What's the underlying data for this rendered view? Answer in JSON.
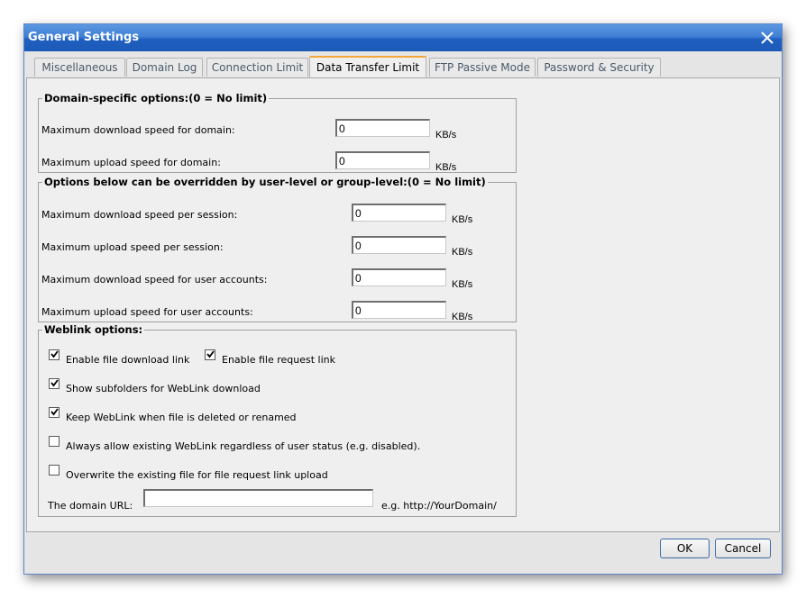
{
  "dialog": {
    "title": "General Settings",
    "close_icon": "close-icon"
  },
  "tabs": [
    {
      "label": "Miscellaneous",
      "active": false
    },
    {
      "label": "Domain Log",
      "active": false
    },
    {
      "label": "Connection Limit",
      "active": false
    },
    {
      "label": "Data Transfer Limit",
      "active": true
    },
    {
      "label": "FTP Passive Mode",
      "active": false
    },
    {
      "label": "Password & Security",
      "active": false
    }
  ],
  "domain_group": {
    "legend": "Domain-specific options:(0 = No limit)",
    "rows": [
      {
        "label": "Maximum download speed for domain:",
        "value": "0",
        "unit": "KB/s"
      },
      {
        "label": "Maximum upload speed for domain:",
        "value": "0",
        "unit": "KB/s"
      }
    ]
  },
  "override_group": {
    "legend": "Options below can be overridden by user-level or group-level:(0 = No limit)",
    "rows": [
      {
        "label": "Maximum download speed per session:",
        "value": "0",
        "unit": "KB/s"
      },
      {
        "label": "Maximum upload speed per session:",
        "value": "0",
        "unit": "KB/s"
      },
      {
        "label": "Maximum download speed for user accounts:",
        "value": "0",
        "unit": "KB/s"
      },
      {
        "label": "Maximum upload speed for user accounts:",
        "value": "0",
        "unit": "KB/s"
      }
    ]
  },
  "weblink_group": {
    "legend": "Weblink options:",
    "checkboxes": [
      {
        "label": "Enable file download link",
        "checked": true
      },
      {
        "label": "Enable file request link",
        "checked": true
      },
      {
        "label": "Show subfolders for WebLink download",
        "checked": true
      },
      {
        "label": "Keep WebLink when file is deleted or renamed",
        "checked": true
      },
      {
        "label": "Always allow existing WebLink regardless of user status (e.g. disabled).",
        "checked": false
      },
      {
        "label": "Overwrite the existing file for file request link upload",
        "checked": false
      }
    ],
    "domain_url": {
      "label": "The domain URL:",
      "value": "",
      "hint": "e.g. http://YourDomain/"
    }
  },
  "buttons": {
    "ok": "OK",
    "cancel": "Cancel"
  }
}
